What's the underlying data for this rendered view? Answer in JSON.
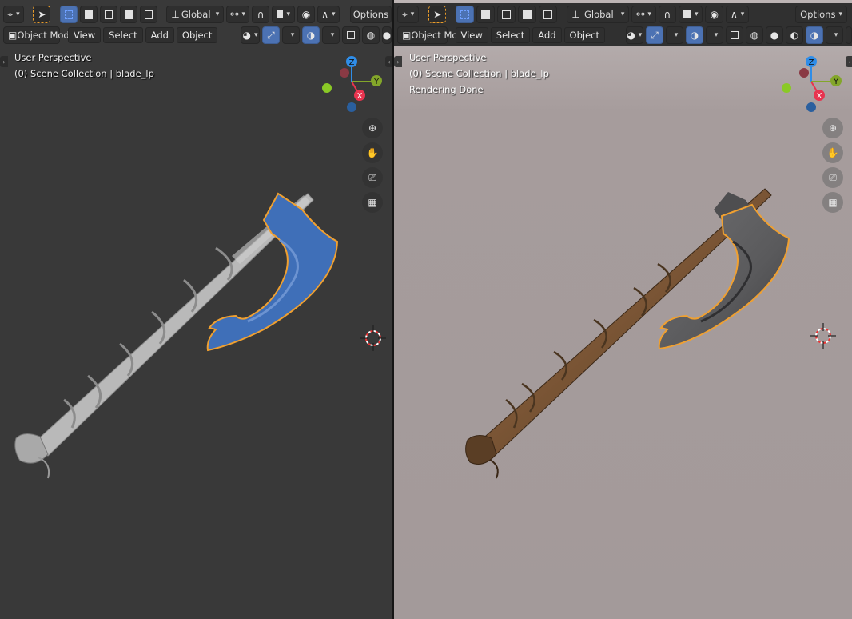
{
  "header": {
    "orientation_label": "Global",
    "options_label": "Options",
    "mode_label": "Object Mode",
    "menus": [
      "View",
      "Select",
      "Add",
      "Object"
    ]
  },
  "left_viewport": {
    "view_name": "User Perspective",
    "collection_info": "(0) Scene Collection | blade_lp",
    "shading": "solid"
  },
  "right_viewport": {
    "view_name": "User Perspective",
    "collection_info": "(0) Scene Collection | blade_lp",
    "render_status": "Rendering Done",
    "shading": "rendered"
  },
  "gizmo": {
    "x_label": "X",
    "y_label": "Y",
    "z_label": "Z"
  },
  "colors": {
    "selection_outline": "#f0a030",
    "blade_blue": "#3f6fb8",
    "axis_x": "#e8344f",
    "axis_y": "#83a62a",
    "axis_z": "#2f8de8"
  },
  "nav_icons": [
    "zoom-icon",
    "pan-hand-icon",
    "camera-icon",
    "grid-icon"
  ]
}
